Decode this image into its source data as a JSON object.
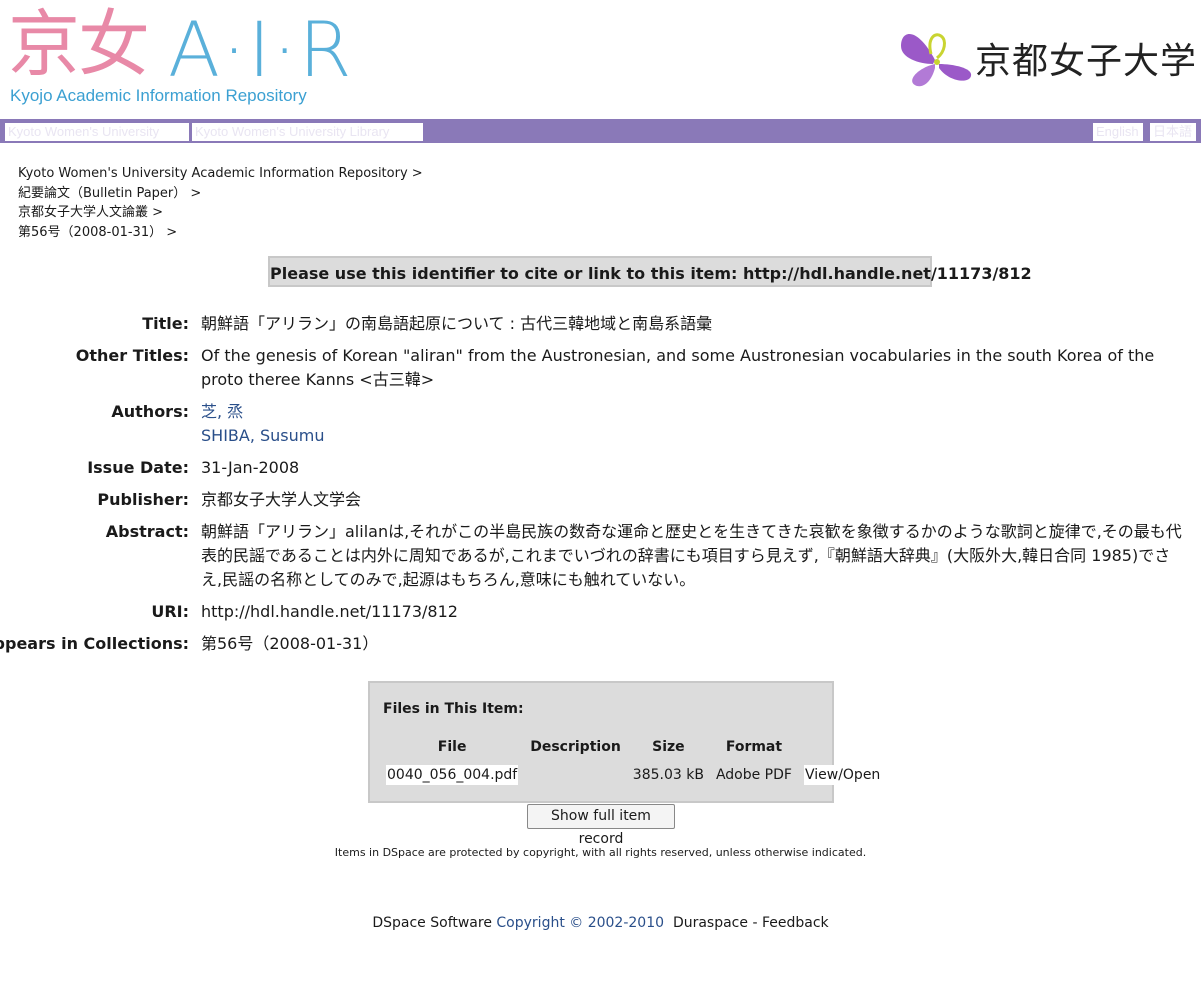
{
  "header": {
    "logo_kanji": "京女",
    "logo_air": "A·I·R",
    "logo_subtitle": "Kyojo Academic Information Repository",
    "university_name": "京都女子大学"
  },
  "nav": {
    "left_links": [
      "Kyoto Women's University",
      "Kyoto Women's University Library"
    ],
    "right_links": [
      "English",
      "日本語"
    ]
  },
  "breadcrumb": [
    "Kyoto Women's University Academic Information Repository >",
    "紀要論文（Bulletin Paper） >",
    "京都女子大学人文論叢 >",
    "第56号（2008-01-31） >"
  ],
  "cite_notice": "Please use this identifier to cite or link to this item: http://hdl.handle.net/11173/812",
  "metadata": {
    "title_label": "Title:",
    "title": "朝鮮語「アリラン」の南島語起原について : 古代三韓地域と南島系語彙",
    "other_titles_label": "Other Titles:",
    "other_titles": "Of the genesis of Korean \"aliran\" from the Austronesian, and some Austronesian vocabularies in the south Korea of the proto theree Kanns <古三韓>",
    "authors_label": "Authors:",
    "authors": [
      "芝, 烝",
      "SHIBA, Susumu"
    ],
    "issue_date_label": "Issue Date:",
    "issue_date": "31-Jan-2008",
    "publisher_label": "Publisher:",
    "publisher": "京都女子大学人文学会",
    "abstract_label": "Abstract:",
    "abstract": "朝鮮語「アリラン」alilanは,それがこの半島民族の数奇な運命と歴史とを生きてきた哀歓を象徴するかのような歌詞と旋律で,その最も代表的民謡であることは内外に周知であるが,これまでいづれの辞書にも項目すら見えず,『朝鮮語大辞典』(大阪外大,韓日合同 1985)でさえ,民謡の名称としてのみで,起源はもちろん,意味にも触れていない。",
    "uri_label": "URI:",
    "uri": "http://hdl.handle.net/11173/812",
    "collections_label": "Appears in Collections:",
    "collections": "第56号（2008-01-31）"
  },
  "files": {
    "heading": "Files in This Item:",
    "columns": [
      "File",
      "Description",
      "Size",
      "Format",
      ""
    ],
    "rows": [
      {
        "file": "0040_056_004.pdf",
        "description": "",
        "size": "385.03 kB",
        "format": "Adobe PDF",
        "action": "View/Open"
      }
    ]
  },
  "show_full_record_label": "Show full item record",
  "copyright_notice": "Items in DSpace are protected by copyright, with all rights reserved, unless otherwise indicated.",
  "footer": {
    "software": "DSpace Software",
    "copyright": "Copyright © 2002-2010",
    "duraspace": "Duraspace",
    "separator": "-",
    "feedback": "Feedback"
  },
  "colors": {
    "nav_bar": "#8a79b8",
    "logo_pink": "#e889a7",
    "logo_blue": "#5ab0da",
    "butterfly_purple": "#9b59c8",
    "butterfly_yellow": "#c9d431"
  }
}
